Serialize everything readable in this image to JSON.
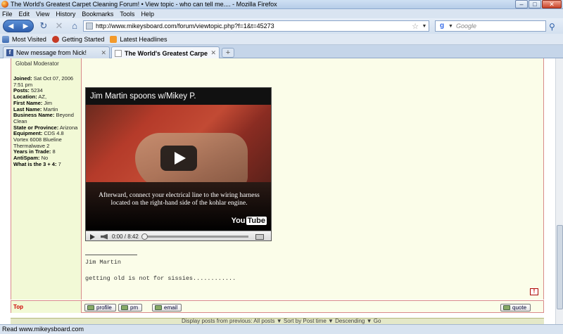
{
  "window": {
    "title": "The World's Greatest Carpet Cleaning Forum! • View topic - who can tell me.... - Mozilla Firefox",
    "minimize": "–",
    "maximize": "□",
    "close": "✕"
  },
  "menu": [
    "File",
    "Edit",
    "View",
    "History",
    "Bookmarks",
    "Tools",
    "Help"
  ],
  "nav": {
    "url": "http://www.mikeysboard.com/forum/viewtopic.php?f=1&t=45273",
    "search_placeholder": "Google"
  },
  "bookmarks": [
    "Most Visited",
    "Getting Started",
    "Latest Headlines"
  ],
  "tabs": [
    {
      "label": "New message from Nick!",
      "active": false
    },
    {
      "label": "The World's Greatest Carpet Clea...",
      "active": true
    }
  ],
  "profile": {
    "rank": "Global Moderator",
    "fields": [
      {
        "label": "Joined:",
        "value": "Sat Oct 07, 2006 7:51 pm"
      },
      {
        "label": "Posts:",
        "value": "5234"
      },
      {
        "label": "Location:",
        "value": "AZ,"
      },
      {
        "label": "First Name:",
        "value": "Jim"
      },
      {
        "label": "Last Name:",
        "value": "Martin"
      },
      {
        "label": "Business Name:",
        "value": "Beyond Clean"
      },
      {
        "label": "State or Province:",
        "value": "Arizona"
      },
      {
        "label": "Equipment:",
        "value": "CDS 4.8 Vortex 6008 Blueline Thermalwave 2"
      },
      {
        "label": "Years in Trade:",
        "value": "8"
      },
      {
        "label": "AntiSpam:",
        "value": "No"
      },
      {
        "label": "What is the 3 + 4:",
        "value": "7"
      }
    ]
  },
  "video": {
    "title": "Jim Martin spoons w/Mikey P.",
    "caption": "Afterward, connect your electrical line to the wiring harness located on the right-hand side of the kohlar engine.",
    "brand_you": "You",
    "brand_tube": "Tube",
    "time": "0:00 / 8:42"
  },
  "signature": {
    "name": "Jim Martin",
    "quote": "getting old is not for sissies............"
  },
  "post_footer": {
    "top_link": "Top",
    "profile": "profile",
    "pm": "pm",
    "email": "email",
    "quote": "quote",
    "report": "!"
  },
  "display_bar": "Display posts from previous: All posts ▼ Sort by Post time ▼ Descending ▼ Go",
  "status": "Read www.mikeysboard.com"
}
